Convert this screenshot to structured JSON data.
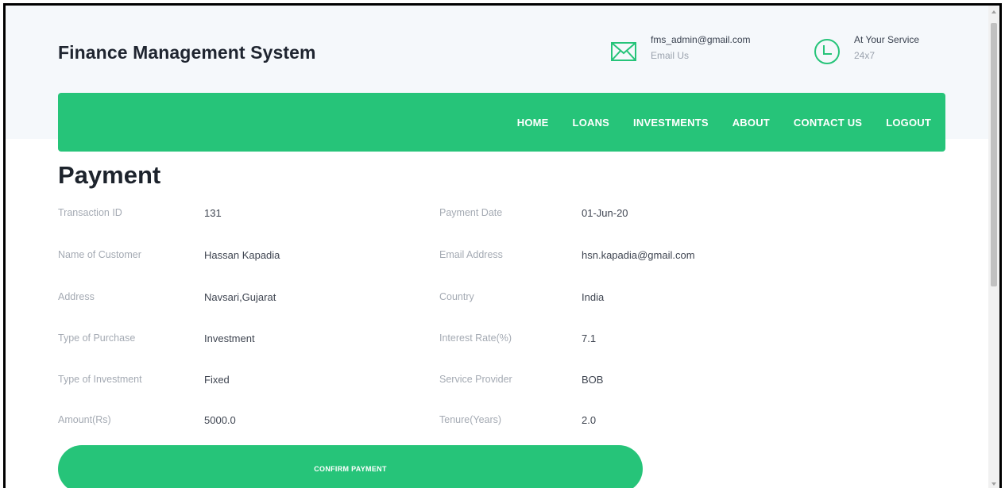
{
  "header": {
    "brand": "Finance Management System",
    "email": {
      "main": "fms_admin@gmail.com",
      "sub": "Email Us",
      "icon": "envelope-icon"
    },
    "service": {
      "main": "At Your Service",
      "sub": "24x7",
      "icon": "clock-icon"
    }
  },
  "nav": {
    "items": [
      "HOME",
      "LOANS",
      "INVESTMENTS",
      "ABOUT",
      "CONTACT US",
      "LOGOUT"
    ]
  },
  "page": {
    "title": "Payment"
  },
  "fields": [
    {
      "label": "Transaction ID",
      "value": "131"
    },
    {
      "label": "Payment Date",
      "value": "01-Jun-20"
    },
    {
      "label": "Name of Customer",
      "value": "Hassan Kapadia"
    },
    {
      "label": "Email Address",
      "value": "hsn.kapadia@gmail.com"
    },
    {
      "label": "Address",
      "value": "Navsari,Gujarat"
    },
    {
      "label": "Country",
      "value": "India"
    },
    {
      "label": "Type of Purchase",
      "value": "Investment"
    },
    {
      "label": "Interest Rate(%)",
      "value": "7.1"
    },
    {
      "label": "Type of Investment",
      "value": "Fixed"
    },
    {
      "label": "Service Provider",
      "value": "BOB"
    },
    {
      "label": "Amount(Rs)",
      "value": "5000.0"
    },
    {
      "label": "Tenure(Years)",
      "value": "2.0"
    }
  ],
  "actions": {
    "confirm": "CONFIRM PAYMENT"
  },
  "colors": {
    "accent": "#26c479",
    "topband": "#f5f8fb"
  }
}
